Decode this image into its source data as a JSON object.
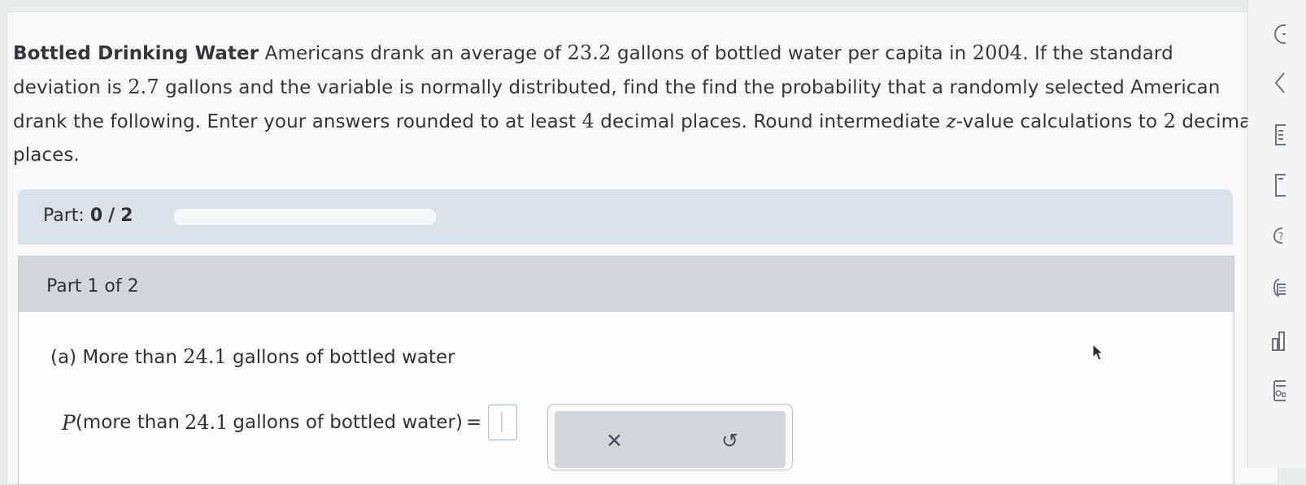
{
  "problem": {
    "title": "Bottled Drinking Water",
    "segment_1": "Americans drank an average of",
    "mean": "23.2",
    "segment_2": "gallons of bottled water per capita in",
    "year": "2004",
    "segment_3": ". If the standard deviation is",
    "sd": "2.7",
    "segment_4": "gallons and the variable is normally distributed, find the find the probability that a randomly selected American drank the following. Enter your answers rounded to at least",
    "decimals_answer": "4",
    "segment_5": "decimal places. Round intermediate",
    "z_var": "z",
    "segment_6": "-value calculations to",
    "decimals_z": "2",
    "segment_7": "decimal places."
  },
  "part_progress": {
    "label": "Part:",
    "current": "0",
    "separator": "/",
    "total": "2",
    "fraction_complete": 0
  },
  "part_panel": {
    "heading": "Part 1 of 2"
  },
  "question": {
    "letter": "(a)",
    "text_1": "More than",
    "amount": "24.1",
    "text_2": "gallons of bottled water"
  },
  "probability": {
    "p": "P",
    "text_open": "(more than",
    "amount": "24.1",
    "text_close": "gallons of bottled water)",
    "equals": "=",
    "answer_value": ""
  },
  "tools": {
    "clear": "✕",
    "undo": "↺"
  },
  "side_icons": [
    "back-icon",
    "collapse-icon",
    "list-icon",
    "document-icon",
    "help-icon",
    "notes-icon",
    "chart-icon",
    "data-icon"
  ],
  "colors": {
    "part_bar": "#d9e2e6",
    "part_head": "#d2d8da",
    "answer_border": "#9cbad1"
  }
}
